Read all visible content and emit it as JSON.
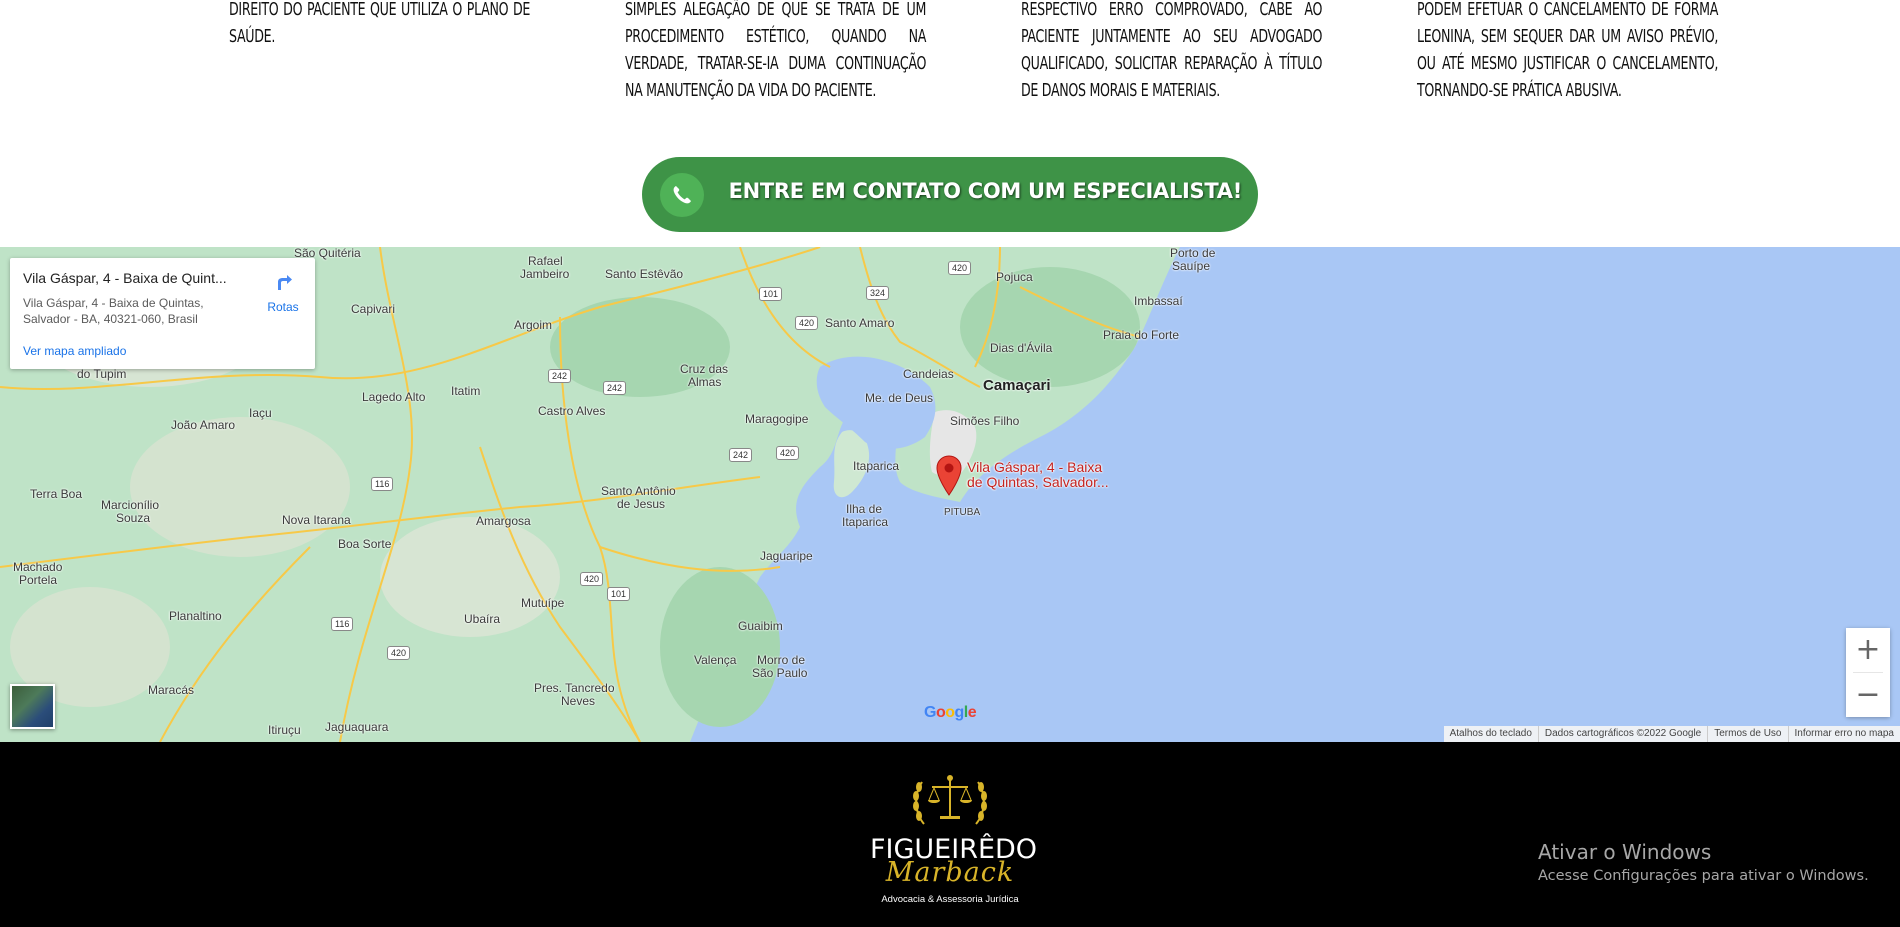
{
  "columns": [
    {
      "text": "direito do paciente que utiliza o plano de saúde."
    },
    {
      "text": "simples alegação de que se trata de um procedimento estético, quando na verdade, tratar-se-ia duma continuação na manutenção da vida do paciente."
    },
    {
      "text": "respectivo erro comprovado, cabe ao paciente juntamente ao seu advogado qualificado, solicitar reparação à título de danos morais e materiais."
    },
    {
      "text": "podem efetuar o cancelamento de forma leonina, sem sequer dar um aviso prévio, ou até mesmo justificar o cancelamento, tornando-se prática abusiva."
    }
  ],
  "cta": {
    "label": "ENTRE EM CONTATO COM UM ESPECIALISTA!",
    "icon": "whatsapp-icon"
  },
  "map": {
    "card": {
      "title": "Vila Gáspar, 4 - Baixa de Quint...",
      "address_line1": "Vila Gáspar, 4 - Baixa de Quintas,",
      "address_line2": "Salvador - BA, 40321-060, Brasil",
      "directions_label": "Rotas",
      "larger_map_label": "Ver mapa ampliado"
    },
    "pin_label_line1": "Vila Gáspar, 4 - Baixa",
    "pin_label_line2": "de Quintas, Salvador...",
    "places": {
      "sao_quiteria": "São Quitéria",
      "rafael_jambeiro_1": "Rafael",
      "rafael_jambeiro_2": "Jambeiro",
      "santo_estevao": "Santo Estêvão",
      "capivari": "Capivari",
      "argoim": "Argoim",
      "santo_amaro": "Santo Amaro",
      "pojuca": "Pojuca",
      "porto_sauipe_1": "Porto de",
      "porto_sauipe_2": "Sauípe",
      "imbassai": "Imbassaí",
      "praia_forte": "Praia do Forte",
      "dias_davila": "Dias d'Ávila",
      "cruz_almas_1": "Cruz das",
      "cruz_almas_2": "Almas",
      "candeias": "Candeias",
      "camacari": "Camaçari",
      "do_tupim": "do Tupim",
      "lagedo_alto": "Lagedo Alto",
      "itatim": "Itatim",
      "castro_alves": "Castro Alves",
      "iacu": "Iaçu",
      "joao_amaro": "João Amaro",
      "me_de_deus": "Me. de Deus",
      "maragogipe": "Maragogipe",
      "simoes_filho": "Simões Filho",
      "itaparica": "Itaparica",
      "terra_boa": "Terra Boa",
      "marcionilio_1": "Marcionílio",
      "marcionilio_2": "Souza",
      "nova_itarana": "Nova Itarana",
      "amargosa": "Amargosa",
      "santo_antonio_1": "Santo Antônio",
      "santo_antonio_2": "de Jesus",
      "ilha_itaparica_1": "Ilha de",
      "ilha_itaparica_2": "Itaparica",
      "pituba": "PITUBA",
      "boa_sorte": "Boa Sorte",
      "jaguaripe": "Jaguaripe",
      "machado_1": "Machado",
      "machado_2": "Portela",
      "mutuipe": "Mutuípe",
      "planaltino": "Planaltino",
      "ubaira": "Ubaíra",
      "guaibim": "Guaibim",
      "valenca": "Valença",
      "morro_1": "Morro de",
      "morro_2": "São Paulo",
      "pres_tancredo_1": "Pres. Tancredo",
      "pres_tancredo_2": "Neves",
      "maracas": "Maracás",
      "itiruçu": "Itiruçu",
      "jaguaquara": "Jaguaquara"
    },
    "roads": [
      "420",
      "101",
      "324",
      "420",
      "242",
      "242",
      "242",
      "420",
      "116",
      "420",
      "101",
      "116",
      "420"
    ],
    "google": [
      "G",
      "o",
      "o",
      "g",
      "l",
      "e"
    ],
    "footer": [
      "Atalhos do teclado",
      "Dados cartográficos ©2022 Google",
      "Termos de Uso",
      "Informar erro no mapa"
    ],
    "zoom_in": "+",
    "zoom_out": "−"
  },
  "footer": {
    "brand": "FIGUEIRÊDO",
    "brand_script": "Marback",
    "tagline": "Advocacia & Assessoria Jurídica"
  },
  "windows_activation": {
    "title": "Ativar o Windows",
    "subtitle": "Acesse Configurações para ativar o Windows."
  },
  "colors": {
    "cta_green": "#3e9347",
    "map_water": "#a9c7f5",
    "map_land": "#bfe3c7",
    "footer_bg": "#000000",
    "logo_gold": "#d8b429"
  }
}
